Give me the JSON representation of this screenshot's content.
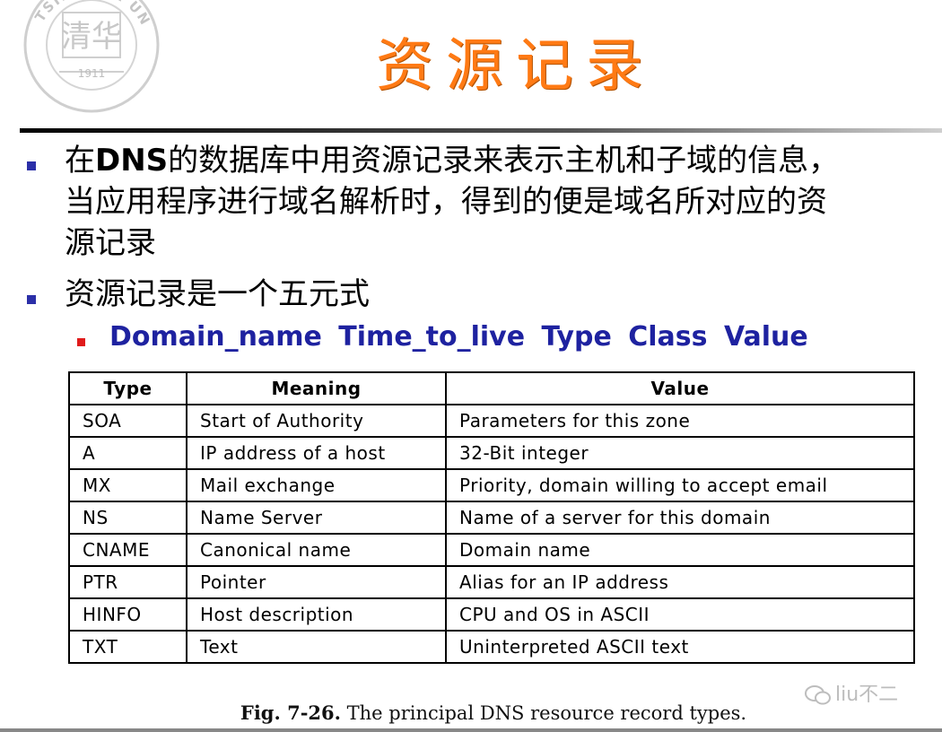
{
  "slide": {
    "title": "资源记录",
    "bullets": [
      {
        "lines_before": "在",
        "bold": "DNS",
        "lines_after_1": "的数据库中用资源记录来表示主机和子域的信息，",
        "line2": "当应用程序进行域名解析时，得到的便是域名所对应的资",
        "line3": "源记录"
      },
      {
        "text": "资源记录是一个五元式"
      }
    ],
    "sub_bullet": "Domain_name  Time_to_live  Type  Class  Value"
  },
  "logo": {
    "text_top": "TSINGHUA UNIVERSITY",
    "year": "1911",
    "colors": {
      "stroke": "#c9c9c9"
    }
  },
  "table": {
    "headers": [
      "Type",
      "Meaning",
      "Value"
    ],
    "rows": [
      [
        "SOA",
        "Start of Authority",
        "Parameters for this zone"
      ],
      [
        "A",
        "IP address of a host",
        "32-Bit integer"
      ],
      [
        "MX",
        "Mail exchange",
        "Priority, domain willing to accept email"
      ],
      [
        "NS",
        "Name Server",
        "Name of a server for this domain"
      ],
      [
        "CNAME",
        "Canonical name",
        "Domain name"
      ],
      [
        "PTR",
        "Pointer",
        "Alias for an IP address"
      ],
      [
        "HINFO",
        "Host description",
        "CPU and OS in ASCII"
      ],
      [
        "TXT",
        "Text",
        "Uninterpreted ASCII text"
      ]
    ]
  },
  "caption": {
    "fig": "Fig.  7-26.",
    "text": " The principal DNS resource record types."
  },
  "watermark": {
    "text": "liu不二"
  },
  "colors": {
    "title": "#ff7a14",
    "bullet": "#2b2fa8",
    "formula": "#1e22a0",
    "sub_bullet": "#e01b1b"
  }
}
